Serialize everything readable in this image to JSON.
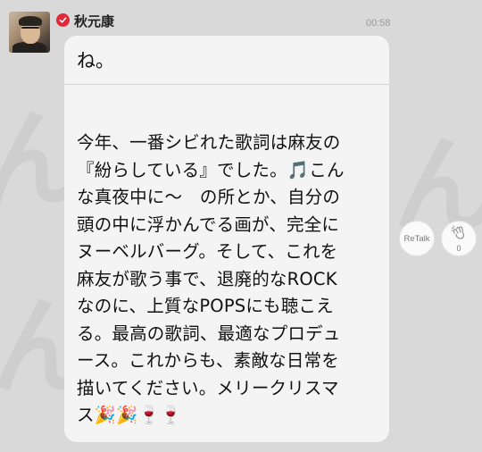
{
  "post": {
    "sender_name": "秋元康",
    "time": "00:58",
    "first_line": "ね。",
    "body": "今年、一番シビれた歌詞は麻友の\n『紛らしている』でした。🎵こん\nな真夜中に〜　の所とか、自分の\n頭の中に浮かんでる画が、完全に\nヌーベルバーグ。そして、これを\n麻友が歌う事で、退廃的なROCK\nなのに、上質なPOPSにも聴こえ\nる。最高の歌詞、最適なプロデュ\nース。これからも、素敵な日常を\n描いてください。メリークリスマ\nス🎉🎉🍷🍷"
  },
  "actions": {
    "retalk_label": "ReTalk",
    "clap_count": "0"
  },
  "icons": {
    "badge": "verified-check-icon",
    "clap": "clap-hands-icon"
  },
  "colors": {
    "badge": "#e0283a",
    "bubble": "#f4f4f4",
    "background": "#d9d9d9"
  }
}
